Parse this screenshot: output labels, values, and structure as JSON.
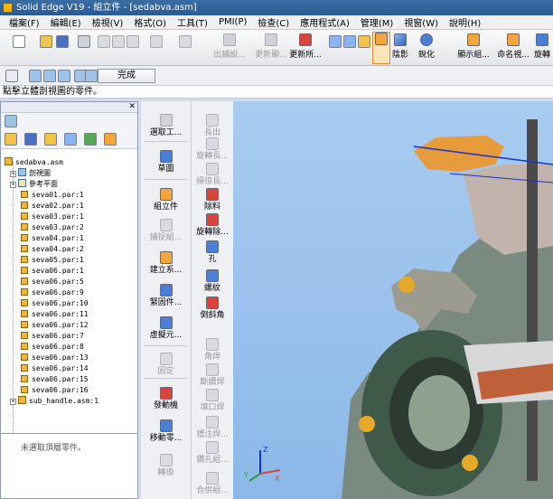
{
  "window": {
    "title": "Solid Edge V19 - 組立件 - [sedabva.asm]"
  },
  "menu": [
    "檔案(F)",
    "編輯(E)",
    "檢視(V)",
    "格式(O)",
    "工具(T)",
    "PMI(P)",
    "檢查(C)",
    "應用程式(A)",
    "管理(M)",
    "視窗(W)",
    "說明(H)"
  ],
  "toolbar": {
    "buttons": [
      {
        "label": "出鋪設...",
        "disabled": true
      },
      {
        "label": "更新顯...",
        "disabled": true
      },
      {
        "label": "更新所...",
        "disabled": false
      },
      {
        "label": "陰影",
        "disabled": false
      },
      {
        "label": "銳化",
        "disabled": false
      },
      {
        "label": "顯示組...",
        "disabled": false
      },
      {
        "label": "命名視...",
        "disabled": false
      },
      {
        "label": "旋轉",
        "disabled": false
      }
    ]
  },
  "command_bar": {
    "done_label": "完成"
  },
  "status": {
    "prompt": "點擊立體剖視圖的零件。"
  },
  "tree": {
    "root": "sedabva.asm",
    "section_view": "剖視圖",
    "ref_planes": "參考平面",
    "parts": [
      "seva01.par:1",
      "seva02.par:1",
      "seva03.par:1",
      "seva03.par:2",
      "seva04.par:1",
      "seva04.par:2",
      "seva05.par:1",
      "seva06.par:1",
      "seva06.par:5",
      "seva06.par:9",
      "seva06.par:10",
      "seva06.par:11",
      "seva06.par:12",
      "seva06.par:7",
      "seva06.par:8",
      "seva06.par:13",
      "seva06.par:14",
      "seva06.par:15",
      "seva06.par:16"
    ],
    "sub_asm": "sub_handle.asm:1"
  },
  "info_panel": {
    "text": "未選取頂層零件。"
  },
  "ribbon_left": [
    {
      "label": "選取工...",
      "disabled": false
    },
    {
      "label": "草圖",
      "disabled": false
    },
    {
      "label": "組立件",
      "disabled": false
    },
    {
      "label": "捕捉組...",
      "disabled": true
    },
    {
      "label": "建立系...",
      "disabled": false
    },
    {
      "label": "緊固件...",
      "disabled": false
    },
    {
      "label": "虛擬元...",
      "disabled": false
    },
    {
      "label": "固定",
      "disabled": true
    },
    {
      "label": "發動機",
      "disabled": false
    },
    {
      "label": "移動零...",
      "disabled": false
    },
    {
      "label": "轉換",
      "disabled": true
    }
  ],
  "ribbon_right": [
    {
      "label": "長出",
      "disabled": true
    },
    {
      "label": "旋轉長...",
      "disabled": true
    },
    {
      "label": "掃掠長...",
      "disabled": true
    },
    {
      "label": "除料",
      "disabled": false
    },
    {
      "label": "旋轉除...",
      "disabled": false
    },
    {
      "label": "孔",
      "disabled": false
    },
    {
      "label": "螺紋",
      "disabled": false
    },
    {
      "label": "倒斜角",
      "disabled": false
    },
    {
      "label": "角焊",
      "disabled": true
    },
    {
      "label": "斷續焊",
      "disabled": true
    },
    {
      "label": "填口焊",
      "disabled": true
    },
    {
      "label": "標注焊...",
      "disabled": true
    },
    {
      "label": "鑽孔組...",
      "disabled": true
    },
    {
      "label": "合併組...",
      "disabled": true
    }
  ],
  "axes": {
    "x": "X",
    "y": "Y",
    "z": "Z"
  }
}
